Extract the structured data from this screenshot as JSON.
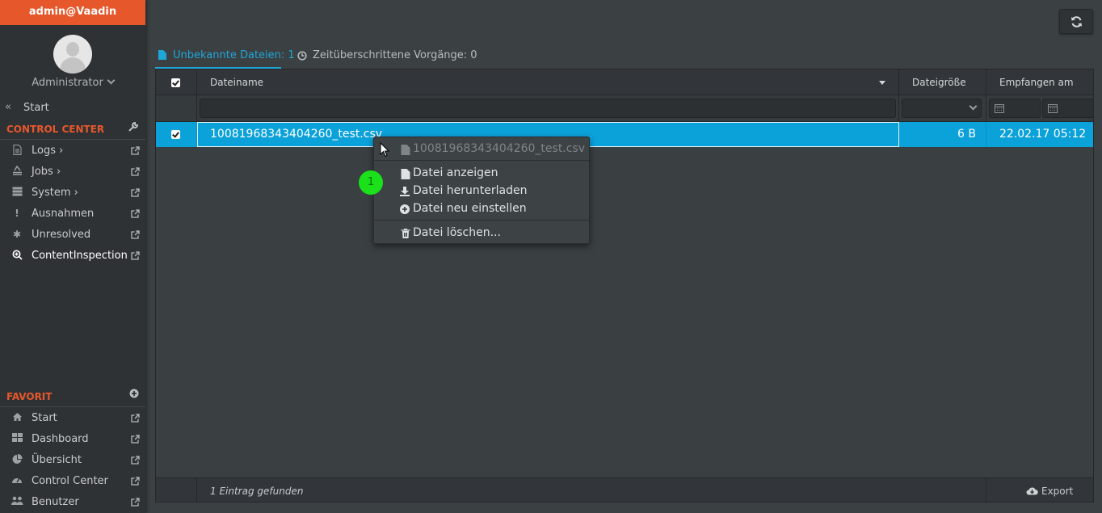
{
  "sidebar": {
    "user_bar": "admin@Vaadin",
    "username": "Administrator",
    "start_link": "Start",
    "control_center": {
      "title": "CONTROL CENTER",
      "items": [
        {
          "label": "Logs",
          "icon": "file-text-icon",
          "has_submenu": true
        },
        {
          "label": "Jobs",
          "icon": "stack-icon",
          "has_submenu": true
        },
        {
          "label": "System",
          "icon": "server-icon",
          "has_submenu": true
        },
        {
          "label": "Ausnahmen",
          "icon": "exclamation-icon",
          "has_submenu": false
        },
        {
          "label": "Unresolved",
          "icon": "asterisk-icon",
          "has_submenu": false
        },
        {
          "label": "ContentInspection",
          "icon": "search-plus-icon",
          "has_submenu": false,
          "active": true
        }
      ]
    },
    "favorit": {
      "title": "FAVORIT",
      "items": [
        {
          "label": "Start",
          "icon": "home-icon"
        },
        {
          "label": "Dashboard",
          "icon": "dashboard-icon"
        },
        {
          "label": "Übersicht",
          "icon": "pie-chart-icon"
        },
        {
          "label": "Control Center",
          "icon": "tachometer-icon"
        },
        {
          "label": "Benutzer",
          "icon": "users-icon"
        }
      ]
    }
  },
  "tabs": [
    {
      "label": "Unbekannte Dateien: 1",
      "selected": true,
      "icon": "file-icon"
    },
    {
      "label": "Zeitüberschrittene Vorgänge: 0",
      "selected": false,
      "icon": "clock-icon"
    }
  ],
  "grid": {
    "columns": [
      "Dateiname",
      "Dateigröße",
      "Empfangen am"
    ],
    "rows": [
      {
        "selected": true,
        "filename": "10081968343404260_test.csv",
        "size": "6 B",
        "received": "22.02.17 05:12"
      }
    ],
    "footer_count": "1 Eintrag gefunden",
    "export_label": "Export"
  },
  "context_menu": {
    "header": "10081968343404260_test.csv",
    "items": [
      {
        "label": "Datei anzeigen",
        "icon": "file-icon"
      },
      {
        "label": "Datei herunterladen",
        "icon": "download-icon"
      },
      {
        "label": "Datei neu einstellen",
        "icon": "plus-circle-icon"
      },
      {
        "label": "Datei löschen...",
        "icon": "trash-icon"
      }
    ]
  },
  "step_badge": "1",
  "colors": {
    "accent": "#e6572b",
    "selection": "#0ba1d9",
    "tab_active": "#1fa6d6",
    "badge": "#1be11b"
  }
}
